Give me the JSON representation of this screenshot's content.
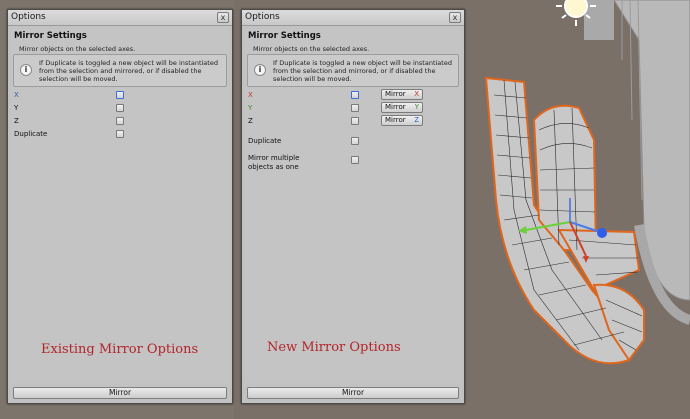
{
  "left_window": {
    "title": "Options",
    "close_glyph": "x",
    "section_title": "Mirror Settings",
    "description": "Mirror objects on the selected axes.",
    "help_icon": "i",
    "help_text": "If Duplicate is toggled a new object will be instantiated from the selection and mirrored, or if disabled the selection will be moved.",
    "options": [
      "X",
      "Y",
      "Z",
      "Duplicate"
    ],
    "caption": "Existing Mirror Options",
    "footer_button": "Mirror"
  },
  "right_window": {
    "title": "Options",
    "close_glyph": "x",
    "section_title": "Mirror Settings",
    "description": "Mirror objects on the selected axes.",
    "help_icon": "i",
    "help_text": "If Duplicate is toggled a new object will be instantiated from the selection and mirrored, or if disabled the selection will be moved.",
    "axes": [
      {
        "label": "X",
        "button": "Mirror",
        "axis": "X"
      },
      {
        "label": "Y",
        "button": "Mirror",
        "axis": "Y"
      },
      {
        "label": "Z",
        "button": "Mirror",
        "axis": "Z"
      }
    ],
    "duplicate_label": "Duplicate",
    "multiple_label_line1": "Mirror multiple",
    "multiple_label_line2": "objects as one",
    "caption": "New Mirror Options",
    "footer_button": "Mirror"
  },
  "colors": {
    "axis_x": "#c0392b",
    "axis_y": "#3a8a2a",
    "axis_z": "#2c5bd0",
    "caption": "#b3242a",
    "selection_outline": "#e0661e"
  },
  "viewport_icons": [
    "sun-icon",
    "move-gizmo-icon"
  ]
}
